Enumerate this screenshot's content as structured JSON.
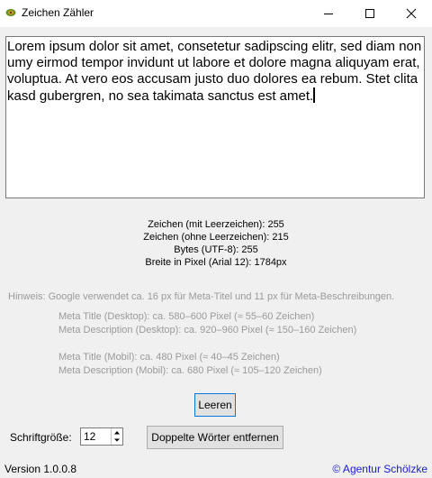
{
  "window": {
    "title": "Zeichen Zähler",
    "icon": "app-icon"
  },
  "editor": {
    "text": "Lorem ipsum dolor sit amet, consetetur sadipscing elitr, sed diam nonumy eirmod tempor invidunt ut labore et dolore magna aliquyam erat, voluptua. At vero eos accusam justo duo dolores ea rebum. Stet clita kasd gubergren, no sea takimata sanctus est amet."
  },
  "stats": {
    "chars_with_spaces": "Zeichen (mit Leerzeichen): 255",
    "chars_without_spaces": "Zeichen (ohne Leerzeichen): 215",
    "bytes": "Bytes (UTF-8): 255",
    "pixel_width": "Breite in Pixel (Arial 12): 1784px"
  },
  "hint": "Hinweis: Google verwendet ca. 16 px für Meta-Titel und 11 px für Meta-Beschreibungen.",
  "meta_desktop": {
    "title": "Meta Title (Desktop): ca. 580–600 Pixel (≈ 55–60 Zeichen)",
    "description": "Meta Description (Desktop): ca. 920–960 Pixel (≈ 150–160 Zeichen)"
  },
  "meta_mobile": {
    "title": "Meta Title (Mobil): ca. 480 Pixel (≈ 40–45 Zeichen)",
    "description": "Meta Description (Mobil): ca. 680 Pixel (≈ 105–120 Zeichen)"
  },
  "buttons": {
    "clear": "Leeren",
    "remove_duplicates": "Doppelte Wörter entfernen"
  },
  "font_size": {
    "label": "Schriftgröße:",
    "value": "12"
  },
  "footer": {
    "version": "Version 1.0.0.8",
    "credit": "© Agentur Schölzke"
  },
  "colors": {
    "hint_text": "#9a9a9a",
    "credit_link": "#1a1ad8",
    "focus_border": "#0078d7"
  }
}
